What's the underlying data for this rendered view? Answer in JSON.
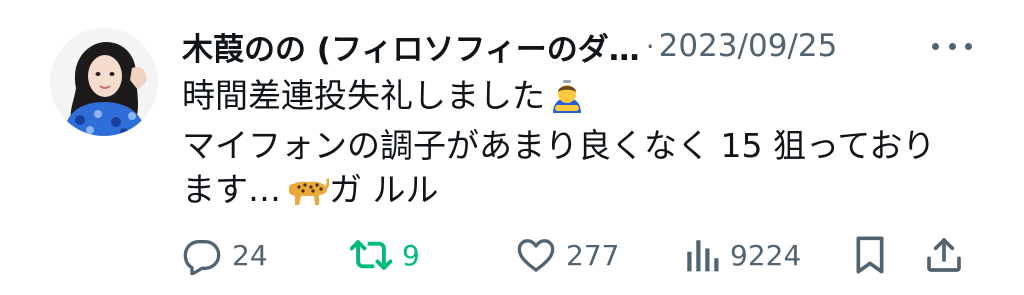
{
  "tweet": {
    "author_name": "木葭のの (フィロソフィーのダ…",
    "separator": "·",
    "date": "2023/09/25",
    "text_lines": [
      "時間差連投失礼しました",
      "マイフォンの調子があまり良くなく 15 狙っており",
      "ます…",
      "ガ ルル"
    ],
    "emoji": [
      "person-bowing-emoji",
      "leopard-emoji"
    ]
  },
  "actions": {
    "reply_count": "24",
    "retweet_count": "9",
    "like_count": "277",
    "views_count": "9224"
  },
  "colors": {
    "text": "#0f1419",
    "secondary": "#536471",
    "retweet_green": "#00ba7c"
  }
}
